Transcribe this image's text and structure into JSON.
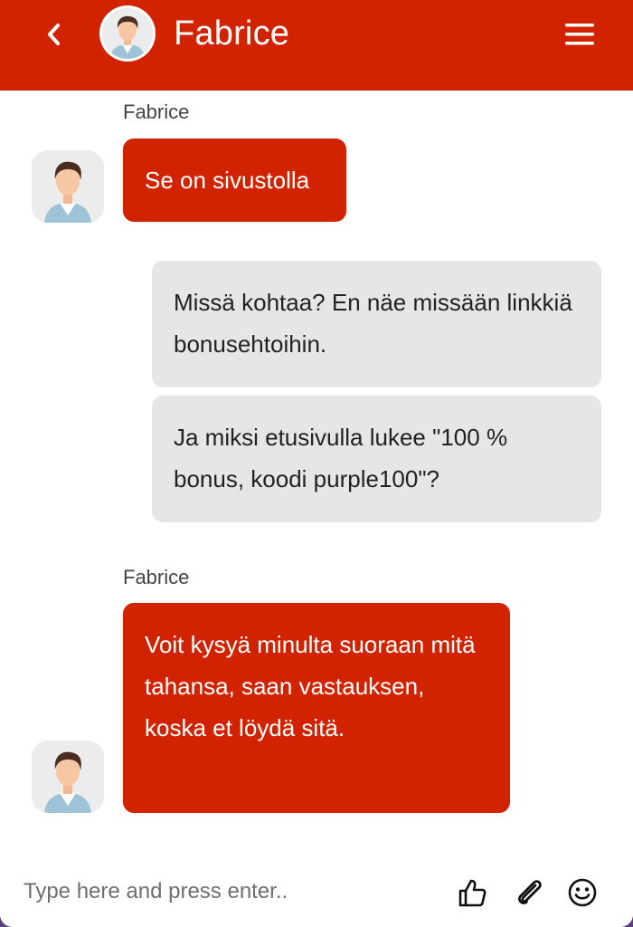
{
  "header": {
    "title": "Fabrice",
    "back_icon": "chevron-left-icon",
    "menu_icon": "hamburger-menu-icon",
    "background_color": "#d12300"
  },
  "messages": [
    {
      "sender": "agent",
      "name": "Fabrice",
      "text": "Se on sivustolla"
    },
    {
      "sender": "user",
      "text": "Missä kohtaa? En näe missään linkkiä bonusehtoihin."
    },
    {
      "sender": "user",
      "text": "Ja miksi etusivulla lukee \"100 % bonus, koodi purple100\"?"
    },
    {
      "sender": "agent",
      "name": "Fabrice",
      "text": "Voit kysyä minulta suoraan mitä tahansa, saan vastauksen, koska et löydä sitä."
    }
  ],
  "composer": {
    "placeholder": "Type here and press enter..",
    "icons": [
      "thumbs-up-icon",
      "paperclip-icon",
      "smiley-icon"
    ]
  },
  "colors": {
    "agent_bubble": "#d12300",
    "user_bubble": "#e6e6e6"
  }
}
